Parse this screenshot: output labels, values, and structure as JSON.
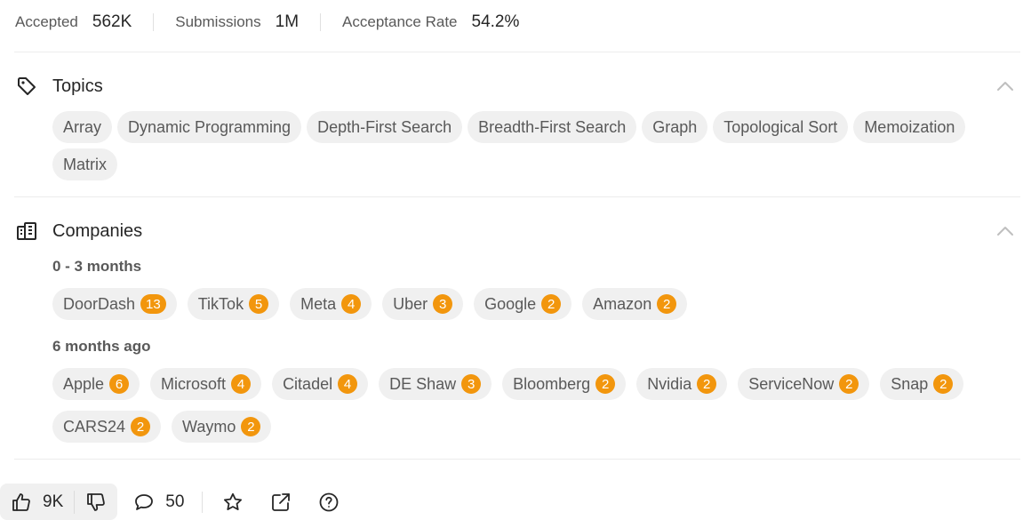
{
  "stats": {
    "accepted_label": "Accepted",
    "accepted_value": "562K",
    "submissions_label": "Submissions",
    "submissions_value": "1M",
    "acceptance_label": "Acceptance Rate",
    "acceptance_value": "54.2%"
  },
  "topics": {
    "title": "Topics",
    "icon": "tag-icon",
    "tags": [
      "Array",
      "Dynamic Programming",
      "Depth-First Search",
      "Breadth-First Search",
      "Graph",
      "Topological Sort",
      "Memoization",
      "Matrix"
    ]
  },
  "companies": {
    "title": "Companies",
    "icon": "building-icon",
    "periods": [
      {
        "label": "0 - 3 months",
        "items": [
          {
            "name": "DoorDash",
            "count": "13"
          },
          {
            "name": "TikTok",
            "count": "5"
          },
          {
            "name": "Meta",
            "count": "4"
          },
          {
            "name": "Uber",
            "count": "3"
          },
          {
            "name": "Google",
            "count": "2"
          },
          {
            "name": "Amazon",
            "count": "2"
          }
        ]
      },
      {
        "label": "6 months ago",
        "items": [
          {
            "name": "Apple",
            "count": "6"
          },
          {
            "name": "Microsoft",
            "count": "4"
          },
          {
            "name": "Citadel",
            "count": "4"
          },
          {
            "name": "DE Shaw",
            "count": "3"
          },
          {
            "name": "Bloomberg",
            "count": "2"
          },
          {
            "name": "Nvidia",
            "count": "2"
          },
          {
            "name": "ServiceNow",
            "count": "2"
          },
          {
            "name": "Snap",
            "count": "2"
          },
          {
            "name": "CARS24",
            "count": "2"
          },
          {
            "name": "Waymo",
            "count": "2"
          }
        ]
      }
    ]
  },
  "footer": {
    "likes": "9K",
    "comments": "50",
    "icons": [
      "thumbs-up-icon",
      "thumbs-down-icon",
      "comment-icon",
      "star-icon",
      "share-icon",
      "help-icon"
    ]
  },
  "colors": {
    "badge": "#f2960d",
    "chip_bg": "#f0f0f0",
    "chip_text": "#595959",
    "divider": "#ececec"
  }
}
